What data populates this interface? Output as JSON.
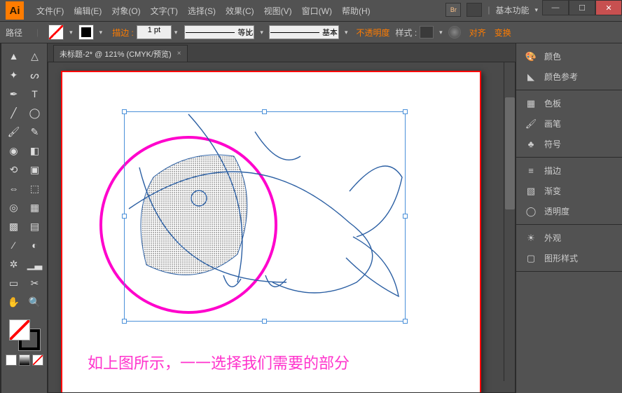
{
  "app": {
    "logo": "Ai"
  },
  "menu": {
    "file": "文件(F)",
    "edit": "编辑(E)",
    "object": "对象(O)",
    "type": "文字(T)",
    "select": "选择(S)",
    "effect": "效果(C)",
    "view": "视图(V)",
    "window": "窗口(W)",
    "help": "帮助(H)"
  },
  "workspace": "基本功能",
  "optbar": {
    "context": "路径",
    "stroke_label": "描边 :",
    "stroke_val": "1 pt",
    "profile": "等比",
    "brush": "基本",
    "opacity_label": "不透明度",
    "style_label": "样式 :",
    "align": "对齐",
    "transform": "变换"
  },
  "tab": {
    "title": "未标题-2* @ 121% (CMYK/预览)"
  },
  "caption": "如上图所示，一一选择我们需要的部分",
  "panels": {
    "g1": {
      "color": "颜色",
      "guide": "颜色参考"
    },
    "g2": {
      "swatches": "色板",
      "brushes": "画笔",
      "symbols": "符号"
    },
    "g3": {
      "stroke": "描边",
      "gradient": "渐变",
      "transparency": "透明度"
    },
    "g4": {
      "appearance": "外观",
      "graphic_styles": "图形样式"
    }
  }
}
